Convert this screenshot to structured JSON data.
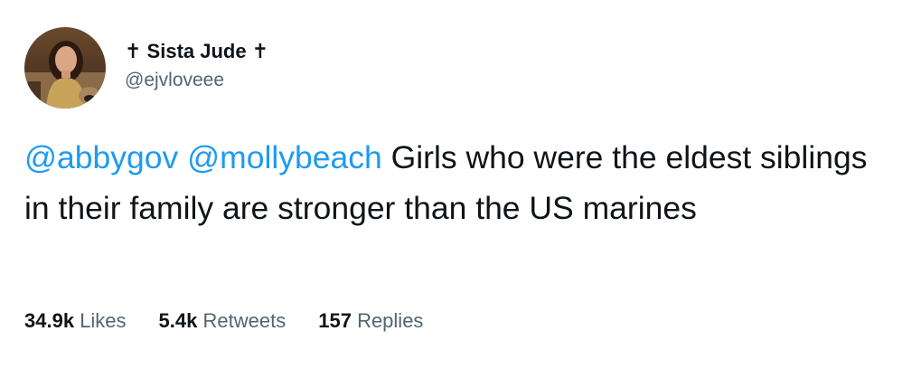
{
  "user": {
    "display_name": "✝ Sista Jude ✝",
    "handle": "@ejvloveee"
  },
  "tweet": {
    "mention_1": "@abbygov",
    "mention_2": "@mollybeach",
    "text": "Girls who were the eldest siblings in their family are stronger than the US marines"
  },
  "stats": {
    "likes_count": "34.9k",
    "likes_label": "Likes",
    "retweets_count": "5.4k",
    "retweets_label": "Retweets",
    "replies_count": "157",
    "replies_label": "Replies"
  },
  "colors": {
    "link": "#1d9bf0",
    "text": "#0f1419",
    "secondary": "#536471"
  }
}
